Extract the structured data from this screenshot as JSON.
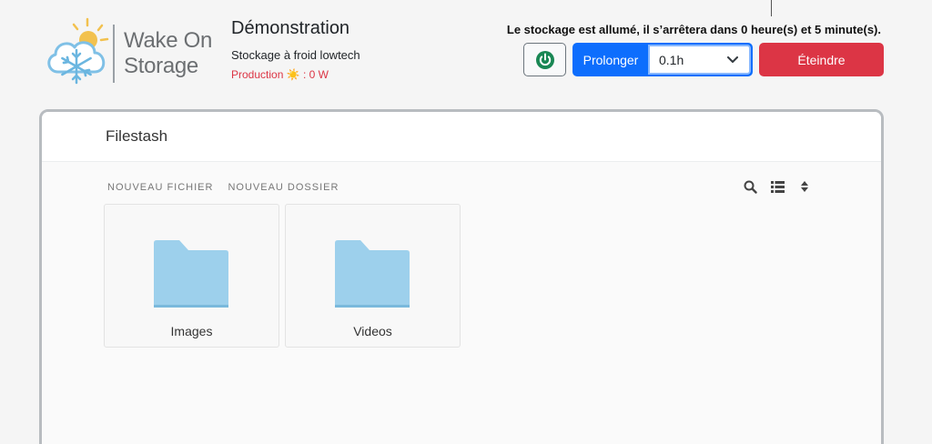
{
  "brand": {
    "name": "Wake On Storage"
  },
  "app": {
    "title": "Démonstration",
    "subtitle": "Stockage à froid lowtech",
    "production": "Production ☀️ : 0 W"
  },
  "status": {
    "message": "Le stockage est allumé, il s’arrêtera dans 0 heure(s) et 5 minute(s)."
  },
  "controls": {
    "power_icon": "power-icon",
    "extend_label": "Prolonger",
    "extend_value": "0.1h",
    "off_label": "Éteindre"
  },
  "filestash": {
    "title": "Filestash",
    "new_file": "NOUVEAU FICHIER",
    "new_folder": "NOUVEAU DOSSIER",
    "icons": [
      "search-icon",
      "list-view-icon",
      "sort-icon"
    ],
    "items": [
      {
        "name": "Images",
        "type": "folder"
      },
      {
        "name": "Videos",
        "type": "folder"
      }
    ]
  },
  "colors": {
    "primary": "#0d6efd",
    "danger": "#dc3545",
    "power_green": "#198754",
    "folder": "#9dd0ec"
  }
}
